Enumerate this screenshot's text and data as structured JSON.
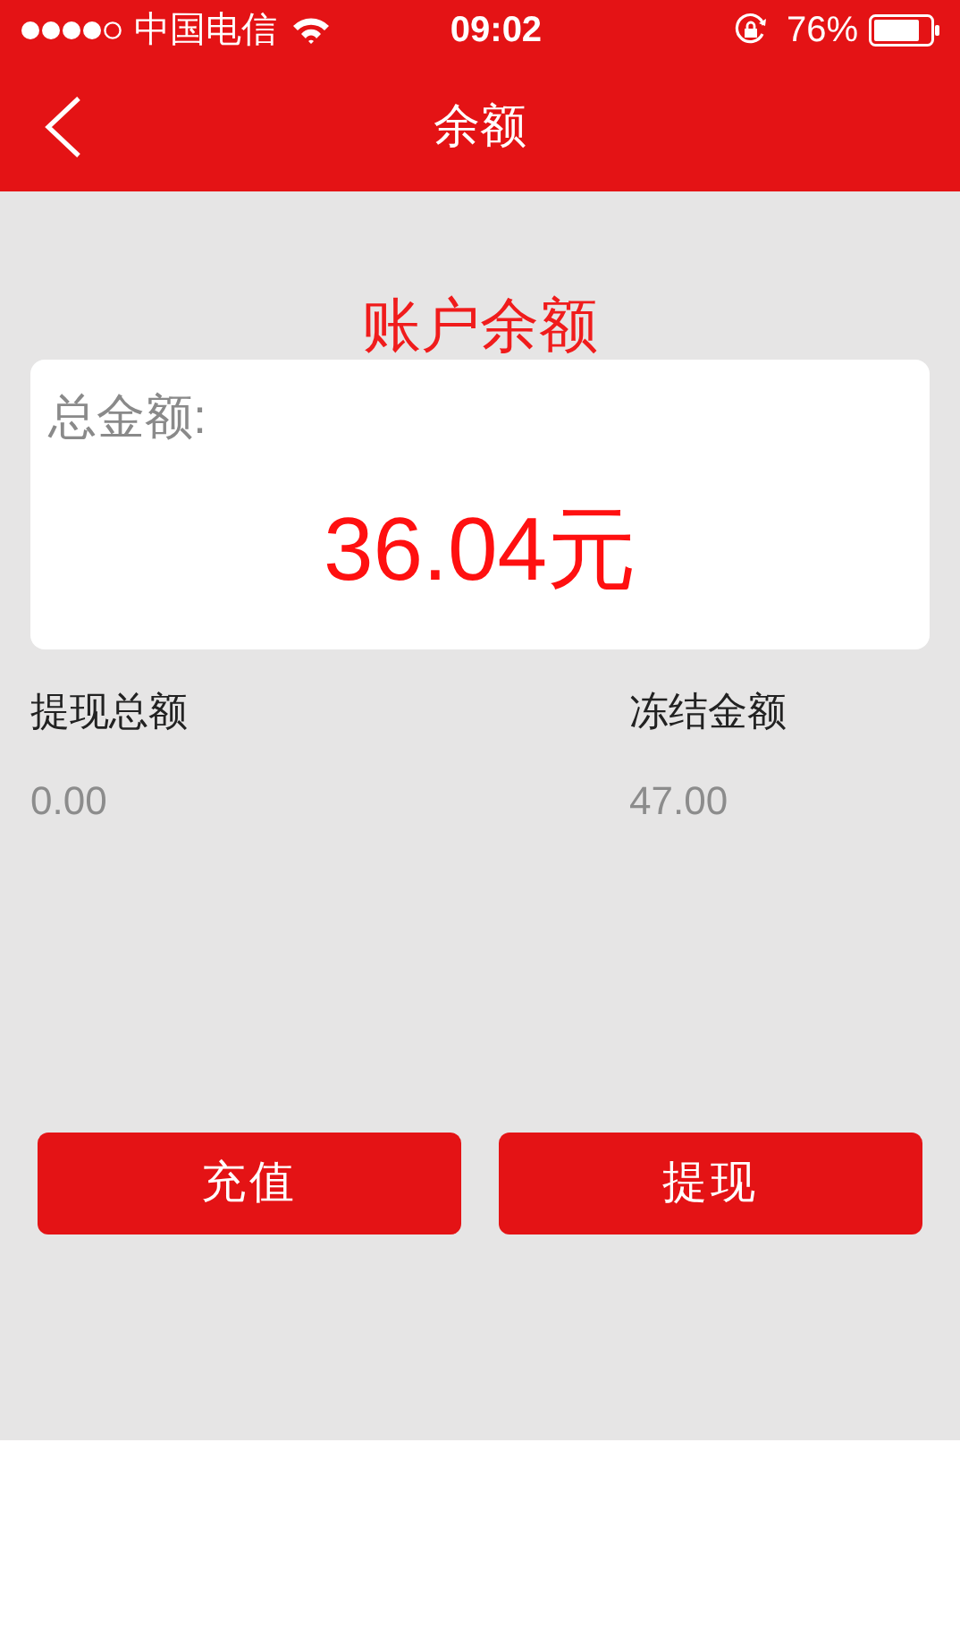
{
  "status_bar": {
    "carrier": "中国电信",
    "time": "09:02",
    "battery": "76%"
  },
  "nav": {
    "title": "余额"
  },
  "balance": {
    "heading": "账户余额",
    "label": "总金额:",
    "amount": "36.04元"
  },
  "stats": [
    {
      "label": "提现总额",
      "value": "0.00"
    },
    {
      "label": "冻结金额",
      "value": "47.00"
    }
  ],
  "buttons": [
    "充值",
    "提现"
  ]
}
